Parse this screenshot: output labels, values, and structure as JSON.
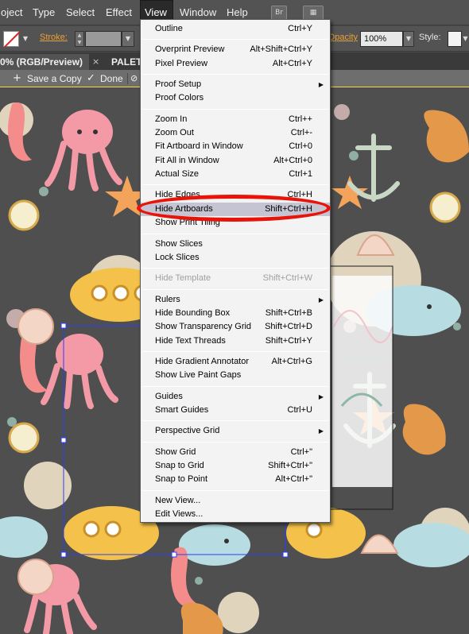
{
  "menubar": {
    "items": [
      "oject",
      "Type",
      "Select",
      "Effect",
      "View",
      "Window",
      "Help"
    ],
    "active": "View",
    "icons": {
      "bridge_label": "Br",
      "arrange_label": "▦"
    }
  },
  "controlbar": {
    "stroke_label": "Stroke:",
    "opacity_label": "Opacity:",
    "opacity_value": "100%",
    "style_label": "Style:"
  },
  "tabs": {
    "doc_tab": "0% (RGB/Preview)",
    "close_glyph": "×",
    "second_tab": "PALET"
  },
  "actionbar": {
    "save_copy_label": "Save a Copy",
    "done_label": "Done",
    "save_icon": "+",
    "done_icon": "✓"
  },
  "view_menu": {
    "groups": [
      [
        {
          "label": "Outline",
          "shortcut": "Ctrl+Y"
        }
      ],
      [
        {
          "label": "Overprint Preview",
          "shortcut": "Alt+Shift+Ctrl+Y"
        },
        {
          "label": "Pixel Preview",
          "shortcut": "Alt+Ctrl+Y"
        }
      ],
      [
        {
          "label": "Proof Setup",
          "shortcut": "",
          "submenu": true
        },
        {
          "label": "Proof Colors",
          "shortcut": ""
        }
      ],
      [
        {
          "label": "Zoom In",
          "shortcut": "Ctrl++"
        },
        {
          "label": "Zoom Out",
          "shortcut": "Ctrl+-"
        },
        {
          "label": "Fit Artboard in Window",
          "shortcut": "Ctrl+0"
        },
        {
          "label": "Fit All in Window",
          "shortcut": "Alt+Ctrl+0"
        },
        {
          "label": "Actual Size",
          "shortcut": "Ctrl+1"
        }
      ],
      [
        {
          "label": "Hide Edges",
          "shortcut": "Ctrl+H"
        },
        {
          "label": "Hide Artboards",
          "shortcut": "Shift+Ctrl+H",
          "highlighted": true
        },
        {
          "label": "Show Print Tiling",
          "shortcut": ""
        }
      ],
      [
        {
          "label": "Show Slices",
          "shortcut": ""
        },
        {
          "label": "Lock Slices",
          "shortcut": ""
        }
      ],
      [
        {
          "label": "Hide Template",
          "shortcut": "Shift+Ctrl+W",
          "disabled": true
        }
      ],
      [
        {
          "label": "Rulers",
          "shortcut": "",
          "submenu": true
        },
        {
          "label": "Hide Bounding Box",
          "shortcut": "Shift+Ctrl+B"
        },
        {
          "label": "Show Transparency Grid",
          "shortcut": "Shift+Ctrl+D"
        },
        {
          "label": "Hide Text Threads",
          "shortcut": "Shift+Ctrl+Y"
        }
      ],
      [
        {
          "label": "Hide Gradient Annotator",
          "shortcut": "Alt+Ctrl+G"
        },
        {
          "label": "Show Live Paint Gaps",
          "shortcut": ""
        }
      ],
      [
        {
          "label": "Guides",
          "shortcut": "",
          "submenu": true
        },
        {
          "label": "Smart Guides",
          "shortcut": "Ctrl+U"
        }
      ],
      [
        {
          "label": "Perspective Grid",
          "shortcut": "",
          "submenu": true
        }
      ],
      [
        {
          "label": "Show Grid",
          "shortcut": "Ctrl+\""
        },
        {
          "label": "Snap to Grid",
          "shortcut": "Shift+Ctrl+\""
        },
        {
          "label": "Snap to Point",
          "shortcut": "Alt+Ctrl+\""
        }
      ],
      [
        {
          "label": "New View...",
          "shortcut": ""
        },
        {
          "label": "Edit Views...",
          "shortcut": ""
        }
      ]
    ]
  },
  "colors": {
    "menu_highlight": "#c4c4d2",
    "callout": "#e8140a",
    "stroke_label": "#e8a13a",
    "selection": "#2a3cff"
  }
}
